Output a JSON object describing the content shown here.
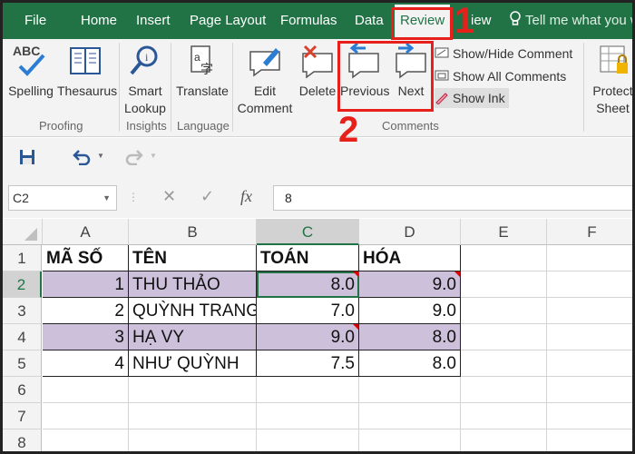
{
  "tabs": [
    {
      "label": "File"
    },
    {
      "label": "Home"
    },
    {
      "label": "Insert"
    },
    {
      "label": "Page Layout"
    },
    {
      "label": "Formulas"
    },
    {
      "label": "Data"
    },
    {
      "label": "Review"
    },
    {
      "label": "iew"
    }
  ],
  "tell_me": "Tell me what you w",
  "ribbon": {
    "spelling": "Spelling",
    "thesaurus": "Thesaurus",
    "abc": "ABC",
    "proofing": "Proofing",
    "smart_lookup_1": "Smart",
    "smart_lookup_2": "Lookup",
    "insights": "Insights",
    "translate": "Translate",
    "language": "Language",
    "edit_comment_1": "Edit",
    "edit_comment_2": "Comment",
    "delete": "Delete",
    "previous": "Previous",
    "next": "Next",
    "show_hide_comment": "Show/Hide Comment",
    "show_all_comments": "Show All Comments",
    "show_ink": "Show Ink",
    "comments": "Comments",
    "protect_1": "Protect",
    "protect_2": "Sheet"
  },
  "name_box": "C2",
  "formula": "8",
  "fx": "fx",
  "columns": [
    "A",
    "B",
    "C",
    "D",
    "E",
    "F"
  ],
  "rows": [
    "1",
    "2",
    "3",
    "4",
    "5",
    "6",
    "7",
    "8"
  ],
  "table": {
    "header": [
      "MÃ SỐ",
      "TÊN",
      "TOÁN",
      "HÓA"
    ],
    "data": [
      [
        "1",
        "THU THẢO",
        "8.0",
        "9.0"
      ],
      [
        "2",
        "QUỲNH TRANG",
        "7.0",
        "9.0"
      ],
      [
        "3",
        "HẠ VY",
        "9.0",
        "8.0"
      ],
      [
        "4",
        "NHƯ QUỲNH",
        "7.5",
        "8.0"
      ]
    ]
  },
  "annotations": {
    "one": "1",
    "two": "2"
  },
  "colors": {
    "excel_green": "#217346",
    "row_fill": "#ccc0da",
    "annotation_red": "#e8201c"
  }
}
